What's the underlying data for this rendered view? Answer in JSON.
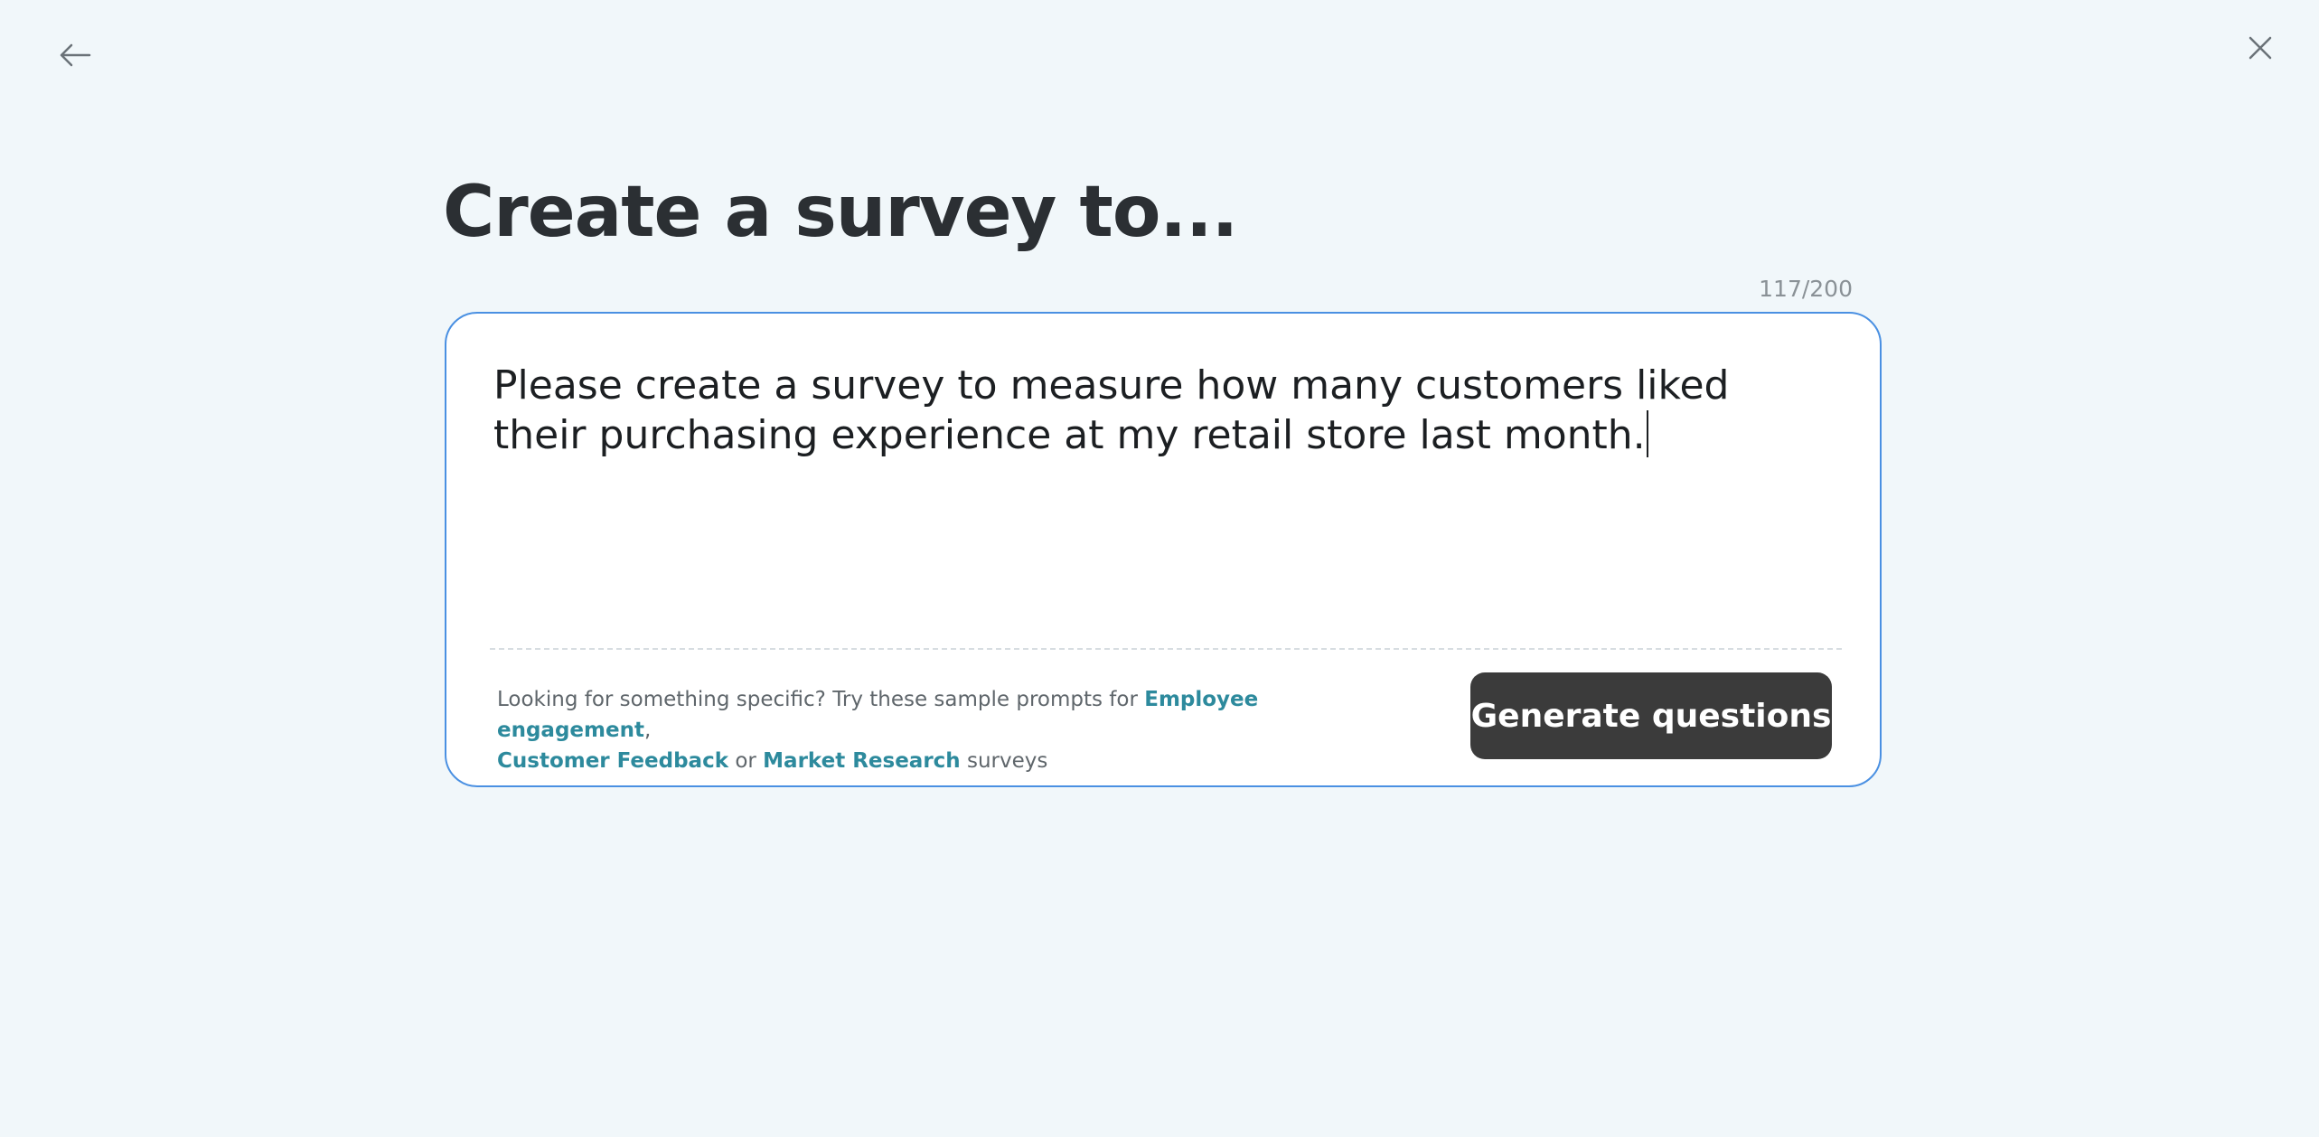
{
  "nav": {
    "back_icon": "arrow-left-icon",
    "close_icon": "close-icon"
  },
  "title": "Create a survey to...",
  "prompt": {
    "counter": "117/200",
    "text": "Please create a survey to measure how many customers liked their purchasing experience at my retail store last month."
  },
  "samples": {
    "intro": "Looking for something specific? Try these sample prompts for ",
    "link_1": "Employee engagement",
    "sep_1": ",",
    "link_2": "Customer Feedback",
    "sep_2": " or ",
    "link_3": "Market Research",
    "suffix": " surveys"
  },
  "generate_button": "Generate questions",
  "colors": {
    "background": "#f1f7fa",
    "card_border": "#4a90e2",
    "link": "#2d8a9d",
    "button_bg": "#3b3b3b"
  }
}
